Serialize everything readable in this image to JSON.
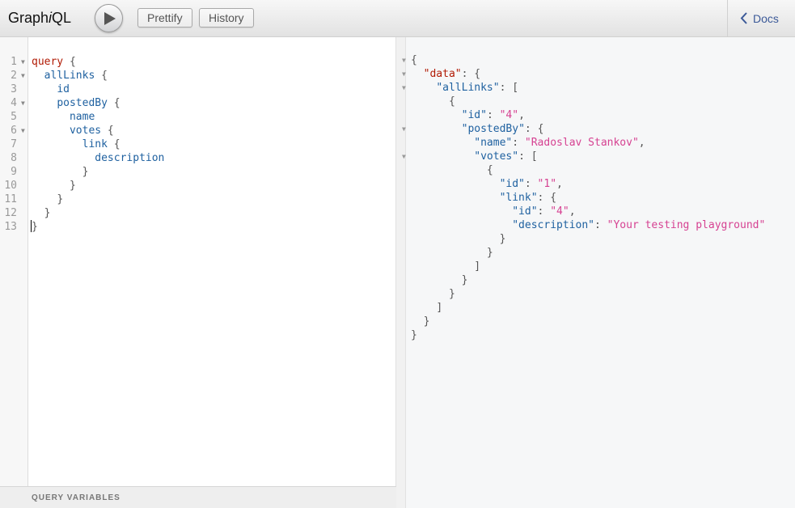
{
  "header": {
    "logo_prefix": "Graph",
    "logo_italic": "i",
    "logo_suffix": "QL",
    "prettify_label": "Prettify",
    "history_label": "History",
    "docs_label": "Docs"
  },
  "editor": {
    "line_numbers": [
      "1",
      "2",
      "3",
      "4",
      "5",
      "6",
      "7",
      "8",
      "9",
      "10",
      "11",
      "12",
      "13"
    ],
    "lines": [
      {
        "indent": "",
        "kw": "query",
        "field": "",
        "punct": " {"
      },
      {
        "indent": "  ",
        "kw": "",
        "field": "allLinks",
        "punct": " {"
      },
      {
        "indent": "    ",
        "kw": "",
        "field": "id",
        "punct": ""
      },
      {
        "indent": "    ",
        "kw": "",
        "field": "postedBy",
        "punct": " {"
      },
      {
        "indent": "      ",
        "kw": "",
        "field": "name",
        "punct": ""
      },
      {
        "indent": "      ",
        "kw": "",
        "field": "votes",
        "punct": " {"
      },
      {
        "indent": "        ",
        "kw": "",
        "field": "link",
        "punct": " {"
      },
      {
        "indent": "          ",
        "kw": "",
        "field": "description",
        "punct": ""
      },
      {
        "indent": "        ",
        "kw": "",
        "field": "",
        "punct": "}"
      },
      {
        "indent": "      ",
        "kw": "",
        "field": "",
        "punct": "}"
      },
      {
        "indent": "    ",
        "kw": "",
        "field": "",
        "punct": "}"
      },
      {
        "indent": "  ",
        "kw": "",
        "field": "",
        "punct": "}"
      },
      {
        "indent": "",
        "kw": "",
        "field": "",
        "punct": "}"
      }
    ]
  },
  "query_variables_label": "QUERY VARIABLES",
  "result": {
    "lines": [
      {
        "indent": "",
        "key": "",
        "sep": "",
        "value": "",
        "tail": "{"
      },
      {
        "indent": "  ",
        "key": "\"data\"",
        "sep": ": ",
        "value": "",
        "tail": "{"
      },
      {
        "indent": "    ",
        "key": "\"allLinks\"",
        "sep": ": ",
        "value": "",
        "tail": "["
      },
      {
        "indent": "      ",
        "key": "",
        "sep": "",
        "value": "",
        "tail": "{"
      },
      {
        "indent": "        ",
        "key": "\"id\"",
        "sep": ": ",
        "value": "\"4\"",
        "tail": ","
      },
      {
        "indent": "        ",
        "key": "\"postedBy\"",
        "sep": ": ",
        "value": "",
        "tail": "{"
      },
      {
        "indent": "          ",
        "key": "\"name\"",
        "sep": ": ",
        "value": "\"Radoslav Stankov\"",
        "tail": ","
      },
      {
        "indent": "          ",
        "key": "\"votes\"",
        "sep": ": ",
        "value": "",
        "tail": "["
      },
      {
        "indent": "            ",
        "key": "",
        "sep": "",
        "value": "",
        "tail": "{"
      },
      {
        "indent": "              ",
        "key": "\"id\"",
        "sep": ": ",
        "value": "\"1\"",
        "tail": ","
      },
      {
        "indent": "              ",
        "key": "\"link\"",
        "sep": ": ",
        "value": "",
        "tail": "{"
      },
      {
        "indent": "                ",
        "key": "\"id\"",
        "sep": ": ",
        "value": "\"4\"",
        "tail": ","
      },
      {
        "indent": "                ",
        "key": "\"description\"",
        "sep": ": ",
        "value": "\"Your testing playground\"",
        "tail": ""
      },
      {
        "indent": "              ",
        "key": "",
        "sep": "",
        "value": "",
        "tail": "}"
      },
      {
        "indent": "            ",
        "key": "",
        "sep": "",
        "value": "",
        "tail": "}"
      },
      {
        "indent": "          ",
        "key": "",
        "sep": "",
        "value": "",
        "tail": "]"
      },
      {
        "indent": "        ",
        "key": "",
        "sep": "",
        "value": "",
        "tail": "}"
      },
      {
        "indent": "      ",
        "key": "",
        "sep": "",
        "value": "",
        "tail": "}"
      },
      {
        "indent": "    ",
        "key": "",
        "sep": "",
        "value": "",
        "tail": "]"
      },
      {
        "indent": "  ",
        "key": "",
        "sep": "",
        "value": "",
        "tail": "}"
      },
      {
        "indent": "",
        "key": "",
        "sep": "",
        "value": "",
        "tail": "}"
      }
    ]
  }
}
